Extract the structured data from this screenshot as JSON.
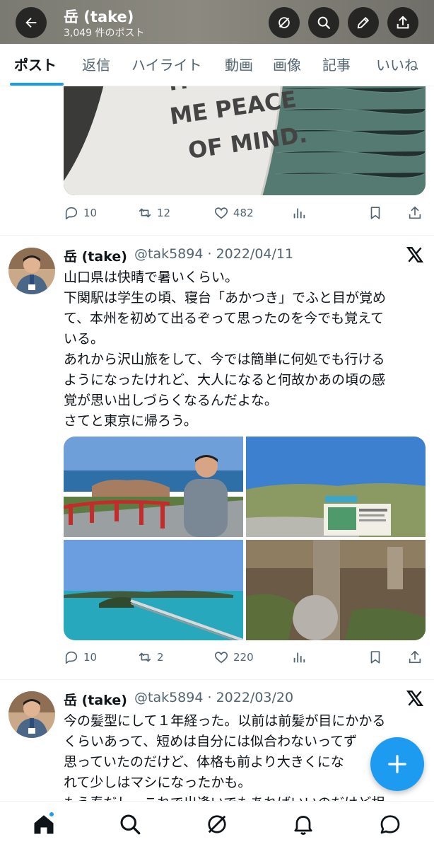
{
  "header": {
    "title": "岳 (take)",
    "post_count": "3,049 件のポスト"
  },
  "tabs": [
    {
      "label": "ポスト",
      "active": true
    },
    {
      "label": "返信",
      "active": false
    },
    {
      "label": "ハイライト",
      "active": false
    },
    {
      "label": "動画",
      "active": false
    },
    {
      "label": "画像",
      "active": false
    },
    {
      "label": "記事",
      "active": false
    },
    {
      "label": "いいね",
      "active": false
    }
  ],
  "top_post": {
    "image_text": [
      "IT BRI",
      "ME PEACE",
      "OF MIND."
    ],
    "replies": "10",
    "reposts": "12",
    "likes": "482"
  },
  "post1": {
    "name": "岳 (take)",
    "meta": "@tak5894 · 2022/04/11",
    "lines": [
      "山口県は快晴で暑いくらい。",
      "下関駅は学生の頃、寝台「あかつき」でふと目が覚め",
      "て、本州を初めて出るぞって思ったのを今でも覚えて",
      "いる。",
      "あれから沢山旅をして、今では簡単に何処でも行ける",
      "ようになったけれど、大人になると何故かあの頃の感",
      "覚が思い出しづらくなるんだよな。",
      "さてと東京に帰ろう。"
    ],
    "replies": "10",
    "reposts": "2",
    "likes": "220"
  },
  "post2": {
    "name": "岳 (take)",
    "meta": "@tak5894 · 2022/03/20",
    "lines": [
      "今の髪型にして１年経った。以前は前髪が目にかかる",
      "くらいあって、短めは自分には似合わないってず",
      "思っていたのだけど、体格も前より大きくにな",
      "れて少しはマシになったかも。",
      "もう春だし、これで出逢いでもあればいいのだけど相"
    ]
  },
  "colors": {
    "accent": "#1d9bf0",
    "text": "#0f1419",
    "secondary": "#536471"
  },
  "icons": {
    "back": "arrow-left-icon",
    "grok": "grok-icon",
    "search": "search-icon",
    "edit": "pencil-icon",
    "share": "share-icon",
    "x": "x-logo-icon"
  }
}
